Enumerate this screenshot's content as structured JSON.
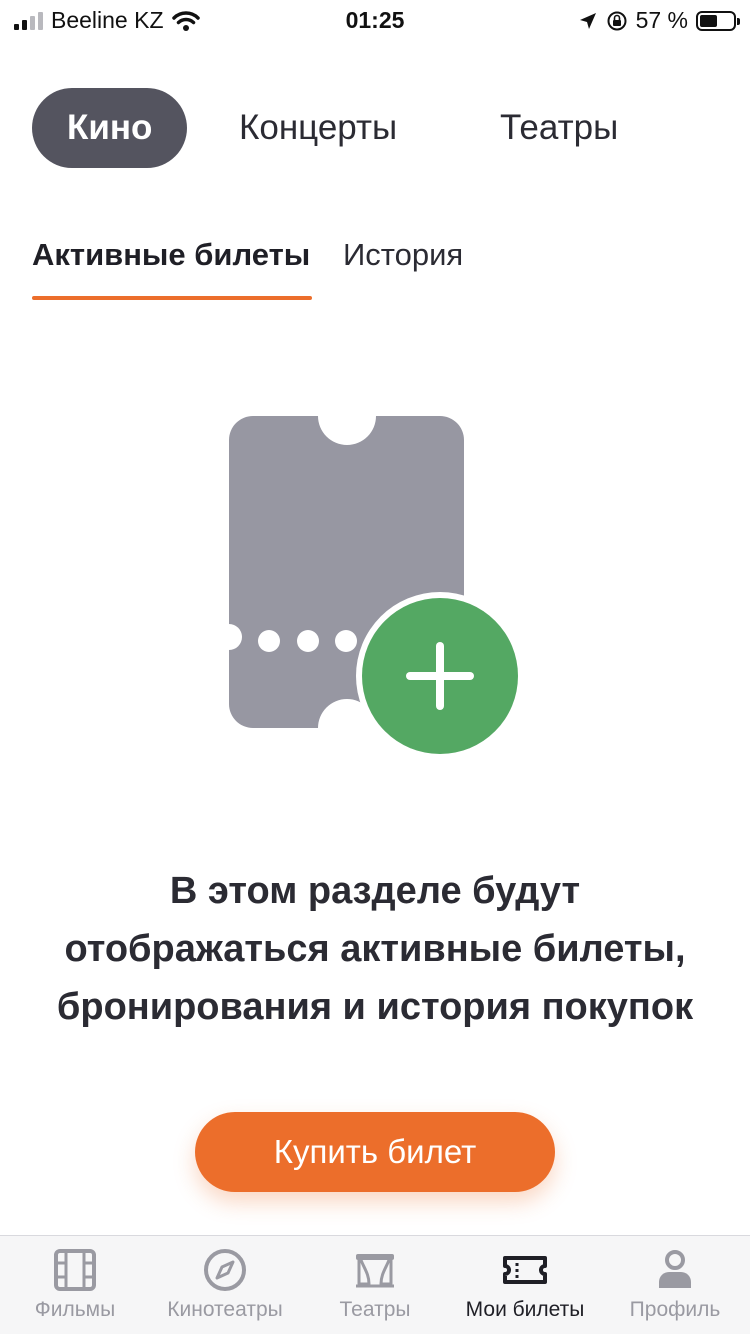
{
  "status_bar": {
    "carrier": "Beeline KZ",
    "time": "01:25",
    "battery_percent": "57 %",
    "battery_level": 0.57,
    "icons": [
      "signal-icon",
      "wifi-icon",
      "location-arrow-icon",
      "orientation-lock-icon",
      "battery-icon"
    ]
  },
  "category_tabs": [
    {
      "label": "Кино",
      "active": true
    },
    {
      "label": "Концерты",
      "active": false
    },
    {
      "label": "Театры",
      "active": false
    }
  ],
  "sub_tabs": [
    {
      "label": "Активные билеты",
      "active": true
    },
    {
      "label": "История",
      "active": false
    }
  ],
  "empty_state": {
    "illustration_icon": "ticket-add-icon",
    "lines": [
      "В этом разделе будут",
      "отображаться активные билеты,",
      "бронирования и история покупок"
    ]
  },
  "buy_button": {
    "label": "Купить билет"
  },
  "bottom_nav": [
    {
      "label": "Фильмы",
      "icon": "film-icon",
      "active": false
    },
    {
      "label": "Кинотеатры",
      "icon": "compass-icon",
      "active": false
    },
    {
      "label": "Театры",
      "icon": "theatre-stage-icon",
      "active": false
    },
    {
      "label": "Мои билеты",
      "icon": "ticket-icon",
      "active": true
    },
    {
      "label": "Профиль",
      "icon": "profile-icon",
      "active": false
    }
  ],
  "colors": {
    "accent": "#ec6e2b",
    "active_tab_bg": "#54545f",
    "ticket_gray": "#9797a2",
    "add_green": "#54a863",
    "inactive_nav": "#9a9aa2"
  }
}
